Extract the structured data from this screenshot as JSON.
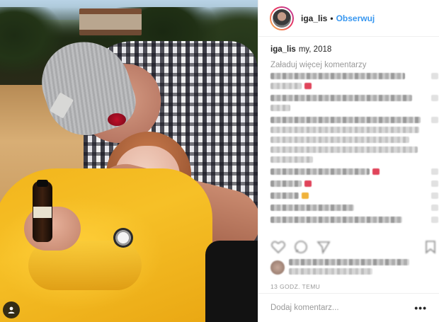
{
  "post": {
    "photo_alt": "",
    "account_icon": "user-account-icon"
  },
  "header": {
    "username": "iga_lis",
    "separator": "•",
    "follow_label": "Obserwuj"
  },
  "caption": {
    "username": "iga_lis",
    "text": "my, 2018"
  },
  "comments": {
    "load_more_label": "Załaduj więcej komentarzy"
  },
  "meta": {
    "timestamp": "13 GODZ. TEMU"
  },
  "add_comment": {
    "placeholder": "Dodaj komentarz...",
    "more_label": "•••"
  },
  "colors": {
    "follow_blue": "#3897f0",
    "text": "#262626",
    "muted": "#999999",
    "story_ring_start": "#f9c14a",
    "story_ring_end": "#b43ca8"
  }
}
